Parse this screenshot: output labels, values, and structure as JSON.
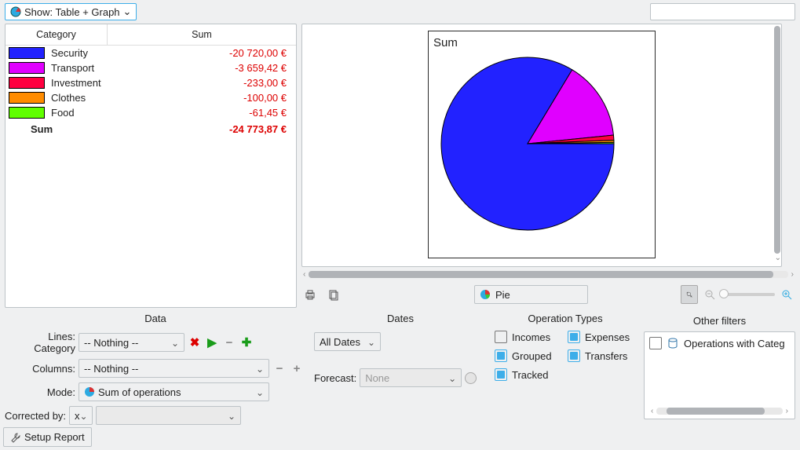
{
  "topbar": {
    "show_label": "Show: Table + Graph"
  },
  "table": {
    "col_category": "Category",
    "col_sum": "Sum",
    "rows": [
      {
        "color": "#2222ff",
        "label": "Security",
        "value": "-20 720,00 €"
      },
      {
        "color": "#e000ff",
        "label": "Transport",
        "value": "-3 659,42 €"
      },
      {
        "color": "#ff0040",
        "label": "Investment",
        "value": "-233,00 €"
      },
      {
        "color": "#ff8c00",
        "label": "Clothes",
        "value": "-100,00 €"
      },
      {
        "color": "#60ff00",
        "label": "Food",
        "value": "-61,45 €"
      }
    ],
    "sum_label": "Sum",
    "sum_value": "-24 773,87 €"
  },
  "chart_data": {
    "type": "pie",
    "title": "Sum",
    "categories": [
      "Security",
      "Transport",
      "Investment",
      "Clothes",
      "Food"
    ],
    "values": [
      20720.0,
      3659.42,
      233.0,
      100.0,
      61.45
    ],
    "colors": [
      "#2222ff",
      "#e000ff",
      "#ff0040",
      "#ff8c00",
      "#60ff00"
    ]
  },
  "graph_controls": {
    "chart_type": "Pie"
  },
  "data_section": {
    "title": "Data",
    "lines_label": "Lines: Category",
    "lines_value": "-- Nothing --",
    "columns_label": "Columns:",
    "columns_value": "-- Nothing --",
    "mode_label": "Mode:",
    "mode_value": "Sum of operations",
    "corrected_label": "Corrected by:",
    "corrected_op": "x"
  },
  "dates_section": {
    "title": "Dates",
    "range": "All Dates",
    "forecast_label": "Forecast:",
    "forecast_value": "None"
  },
  "ops_section": {
    "title": "Operation Types",
    "incomes": "Incomes",
    "expenses": "Expenses",
    "grouped": "Grouped",
    "transfers": "Transfers",
    "tracked": "Tracked"
  },
  "filters_section": {
    "title": "Other filters",
    "item": "Operations with Categ"
  },
  "setup": "Setup Report"
}
